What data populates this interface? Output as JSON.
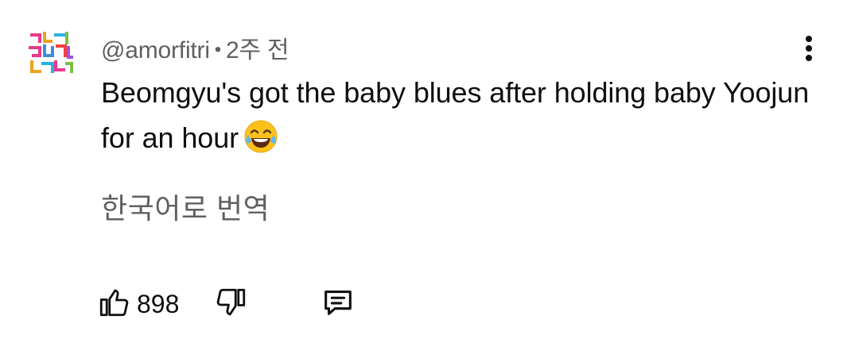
{
  "comment": {
    "author": "@amorfitri",
    "separator": "•",
    "time_ago": "2주 전",
    "text": "Beomgyu's got the baby blues after holding baby Yoojun for an hour",
    "emoji": "face-with-tears-of-joy-icon",
    "translate_label": "한국어로 번역",
    "likes": "898"
  },
  "actions": {
    "like_icon": "thumb-up-icon",
    "dislike_icon": "thumb-down-icon",
    "reply_icon": "reply-comment-icon",
    "menu_icon": "more-vert-icon"
  },
  "colors": {
    "text_primary": "#0f0f0f",
    "text_secondary": "#606060",
    "background": "#ffffff"
  }
}
